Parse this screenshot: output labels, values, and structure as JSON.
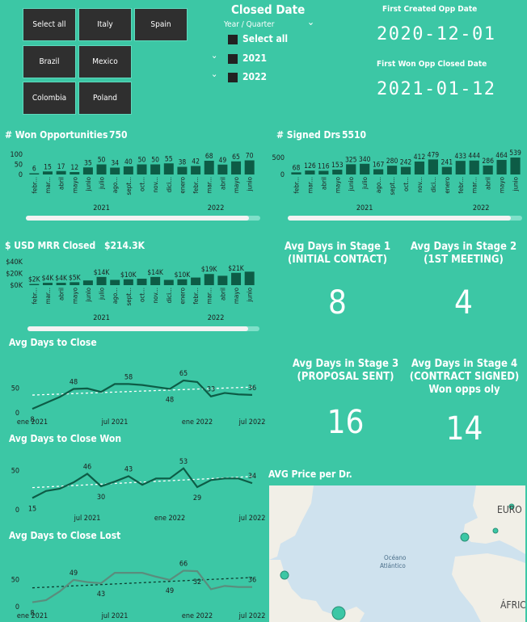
{
  "slicer_countries": [
    "Select all",
    "Italy",
    "Spain",
    "Brazil",
    "Mexico",
    "Colombia",
    "Poland"
  ],
  "closed_date": {
    "title": "Closed Date",
    "subtitle": "Year / Quarter",
    "options": [
      {
        "label": "Select all",
        "expand": false
      },
      {
        "label": "2021",
        "expand": true
      },
      {
        "label": "2022",
        "expand": true
      }
    ]
  },
  "cards": {
    "first_created_title": "First Created Opp Date",
    "first_created_value": "2020-12-01",
    "first_won_title": "First Won Opp Closed Date",
    "first_won_value": "2021-01-12"
  },
  "months": [
    "febr...",
    "mar...",
    "abril",
    "mayo",
    "junio",
    "julio",
    "ago...",
    "sept...",
    "oct...",
    "nov...",
    "dici...",
    "enero",
    "febr...",
    "mar...",
    "abril",
    "mayo",
    "junio"
  ],
  "years": [
    "2021",
    "2022"
  ],
  "won_opportunities": {
    "title": "# Won Opportunities",
    "total": "750",
    "y_ticks": [
      "100",
      "50",
      "0"
    ],
    "chart_data": {
      "type": "bar",
      "ylim": [
        0,
        100
      ],
      "values": [
        6,
        15,
        17,
        12,
        35,
        50,
        34,
        40,
        50,
        50,
        55,
        38,
        42,
        68,
        49,
        65,
        70
      ]
    }
  },
  "signed_drs": {
    "title": "# Signed Drs",
    "total": "5510",
    "y_ticks": [
      "500",
      "0"
    ],
    "chart_data": {
      "type": "bar",
      "ylim": [
        0,
        540
      ],
      "values": [
        68,
        126,
        116,
        153,
        325,
        340,
        167,
        280,
        242,
        412,
        479,
        241,
        433,
        444,
        286,
        464,
        539
      ]
    }
  },
  "usd_mrr": {
    "title": "$ USD MRR Closed",
    "total": "$214.3K",
    "y_ticks": [
      "$40K",
      "$20K",
      "$0K"
    ],
    "labels": [
      "$2K",
      "$4K",
      "$4K",
      "$5K",
      "",
      "$14K",
      "",
      "$10K",
      "",
      "$14K",
      "",
      "$10K",
      "",
      "$19K",
      "",
      "$21K",
      ""
    ],
    "chart_data": {
      "type": "bar",
      "ylim": [
        0,
        40
      ],
      "values": [
        2,
        4,
        4,
        5,
        8,
        14,
        9,
        10,
        11,
        14,
        9,
        10,
        13,
        19,
        16,
        21,
        23
      ]
    }
  },
  "stages": [
    {
      "title_lines": [
        "Avg Days in Stage 1",
        "(INITIAL CONTACT)"
      ],
      "value": "8"
    },
    {
      "title_lines": [
        "Avg Days in Stage 2",
        "(1ST MEETING)"
      ],
      "value": "4"
    },
    {
      "title_lines": [
        "Avg Days in Stage 3",
        "(PROPOSAL SENT)"
      ],
      "value": "16"
    },
    {
      "title_lines": [
        "Avg Days in Stage 4",
        "(CONTRACT SIGNED)",
        "Won opps oly"
      ],
      "value": "14"
    }
  ],
  "line_charts": [
    {
      "title": "Avg Days to Close",
      "color": "#0d5c46",
      "y_ticks": [
        "50",
        "0"
      ],
      "x_ticks": [
        "ene 2021",
        "jul 2021",
        "ene 2022",
        "jul 2022"
      ],
      "chart_data": {
        "type": "line",
        "ylim": [
          0,
          70
        ],
        "values": [
          8,
          20,
          32,
          48,
          49,
          42,
          58,
          58,
          56,
          52,
          48,
          65,
          62,
          33,
          40,
          37,
          36
        ],
        "labels": [
          {
            "i": 0,
            "t": "8"
          },
          {
            "i": 3,
            "t": "48"
          },
          {
            "i": 7,
            "t": "58"
          },
          {
            "i": 10,
            "t": "48"
          },
          {
            "i": 11,
            "t": "65"
          },
          {
            "i": 13,
            "t": "33"
          },
          {
            "i": 16,
            "t": "36"
          }
        ]
      }
    },
    {
      "title": "Avg Days to Close Won",
      "color": "#0d5c46",
      "y_ticks": [
        "50",
        "0"
      ],
      "x_ticks": [
        "jul 2021",
        "ene 2022",
        "jul 2022"
      ],
      "chart_data": {
        "type": "line",
        "ylim": [
          0,
          60
        ],
        "values": [
          15,
          24,
          27,
          35,
          46,
          30,
          36,
          43,
          32,
          40,
          40,
          53,
          29,
          38,
          40,
          40,
          34
        ],
        "labels": [
          {
            "i": 0,
            "t": "15"
          },
          {
            "i": 4,
            "t": "46"
          },
          {
            "i": 5,
            "t": "30"
          },
          {
            "i": 7,
            "t": "43"
          },
          {
            "i": 11,
            "t": "53"
          },
          {
            "i": 12,
            "t": "29"
          },
          {
            "i": 16,
            "t": "34"
          }
        ]
      }
    },
    {
      "title": "Avg Days to Close Lost",
      "color": "#5a8d7d",
      "y_ticks": [
        "50",
        "0"
      ],
      "x_ticks": [
        "ene 2021",
        "jul 2021",
        "ene 2022",
        "jul 2022"
      ],
      "chart_data": {
        "type": "line",
        "ylim": [
          0,
          80
        ],
        "values": [
          8,
          12,
          28,
          49,
          45,
          43,
          62,
          62,
          62,
          55,
          49,
          66,
          65,
          32,
          38,
          36,
          36
        ],
        "labels": [
          {
            "i": 0,
            "t": "8"
          },
          {
            "i": 3,
            "t": "49"
          },
          {
            "i": 5,
            "t": "43"
          },
          {
            "i": 10,
            "t": "49"
          },
          {
            "i": 11,
            "t": "66"
          },
          {
            "i": 12,
            "t": "32"
          },
          {
            "i": 16,
            "t": "36"
          }
        ]
      }
    }
  ],
  "map": {
    "title": "AVG Price per Dr.",
    "labels": {
      "europe": "EURO",
      "ocean_1": "Océano",
      "ocean_2": "Atlántico",
      "africa": "ÁFRIC"
    },
    "land_color": "#f1efe7",
    "water_color": "#cfe2ee"
  },
  "colors": {
    "bar": "#0d5c46",
    "background": "#3cc7a5",
    "slicer": "#2f2f2f"
  }
}
